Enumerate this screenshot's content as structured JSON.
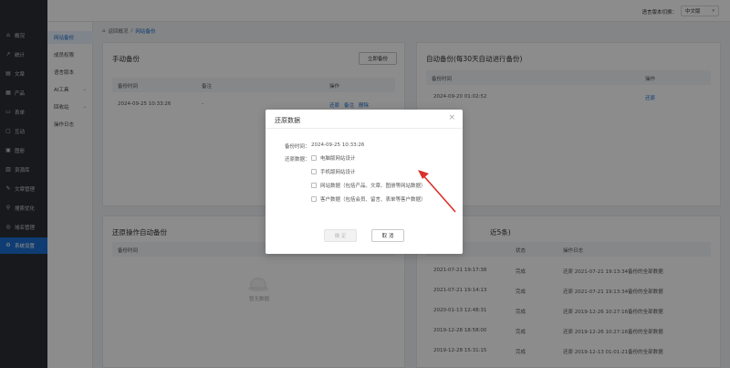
{
  "sidebar": {
    "items": [
      {
        "label": "概况",
        "icon": "home-icon"
      },
      {
        "label": "统计",
        "icon": "chart-icon"
      },
      {
        "label": "文章",
        "icon": "document-icon"
      },
      {
        "label": "产品",
        "icon": "grid-icon"
      },
      {
        "label": "表单",
        "icon": "form-icon"
      },
      {
        "label": "互动",
        "icon": "chat-icon"
      },
      {
        "label": "图册",
        "icon": "image-icon"
      },
      {
        "label": "资源库",
        "icon": "folder-icon"
      },
      {
        "label": "文章管理",
        "icon": "edit-icon"
      },
      {
        "label": "搜索优化",
        "icon": "search-icon"
      },
      {
        "label": "域名管理",
        "icon": "globe-icon"
      },
      {
        "label": "系统设置",
        "icon": "gear-icon"
      }
    ]
  },
  "subnav": {
    "items": [
      {
        "label": "网站备份"
      },
      {
        "label": "成员权限"
      },
      {
        "label": "语言版本"
      },
      {
        "label": "AI工具"
      },
      {
        "label": "回收站"
      },
      {
        "label": "操作日志"
      }
    ]
  },
  "topbar": {
    "lang_label": "语言版本切换：",
    "lang_value": "中文版"
  },
  "breadcrumb": {
    "back": "返回概况",
    "current": "网站备份"
  },
  "manual_backup": {
    "title": "手动备份",
    "button": "立即备份",
    "columns": {
      "time": "备份时间",
      "note": "备注",
      "ops": "操作"
    },
    "row": {
      "time": "2024-09-25 10:33:26",
      "note": "-",
      "restore": "还原",
      "note_link": "备注",
      "delete": "删除"
    }
  },
  "auto_backup": {
    "title": "自动备份(每30天自动进行备份)",
    "columns": {
      "time": "备份时间",
      "ops": "操作"
    },
    "row": {
      "time": "2024-09-20 01:02:52",
      "restore": "还原"
    }
  },
  "restore_auto": {
    "title": "还原操作自动备份",
    "columns": {
      "time": "备份时间"
    },
    "empty_text": "暂无数据"
  },
  "log_card": {
    "title_suffix": "近5条)",
    "columns": {
      "status": "状态",
      "log": "操作日志"
    },
    "rows": [
      {
        "time": "2021-07-21 19:17:38",
        "status": "完成",
        "log": "还原 2021-07-21 19:13:34备份的全部数据"
      },
      {
        "time": "2021-07-21 19:14:13",
        "status": "完成",
        "log": "还原 2021-07-21 19:13:34备份的全部数据"
      },
      {
        "time": "2020-01-13 12:48:31",
        "status": "完成",
        "log": "还原 2019-12-26 10:27:16备份的全部数据"
      },
      {
        "time": "2019-12-28 18:58:00",
        "status": "完成",
        "log": "还原 2019-12-26 10:27:16备份的全部数据"
      },
      {
        "time": "2019-12-28 15:31:15",
        "status": "完成",
        "log": "还原 2019-12-13 01:01:21备份的全部数据"
      }
    ]
  },
  "modal": {
    "title": "还原数据",
    "close": "×",
    "time_label": "备份时间：",
    "time_value": "2024-09-25 10:33:26",
    "restore_label": "还原数据：",
    "options": [
      "电脑版网站设计",
      "手机版网站设计",
      "网站数据（包括产品、文章、图册等网站数据）",
      "客户数据（包括会员、留言、表单等客户数据）"
    ],
    "confirm": "确 定",
    "cancel": "取 消"
  },
  "colors": {
    "accent": "#1c6dd0",
    "sidebar_bg": "#2b2f36",
    "arrow": "#d9312b"
  }
}
